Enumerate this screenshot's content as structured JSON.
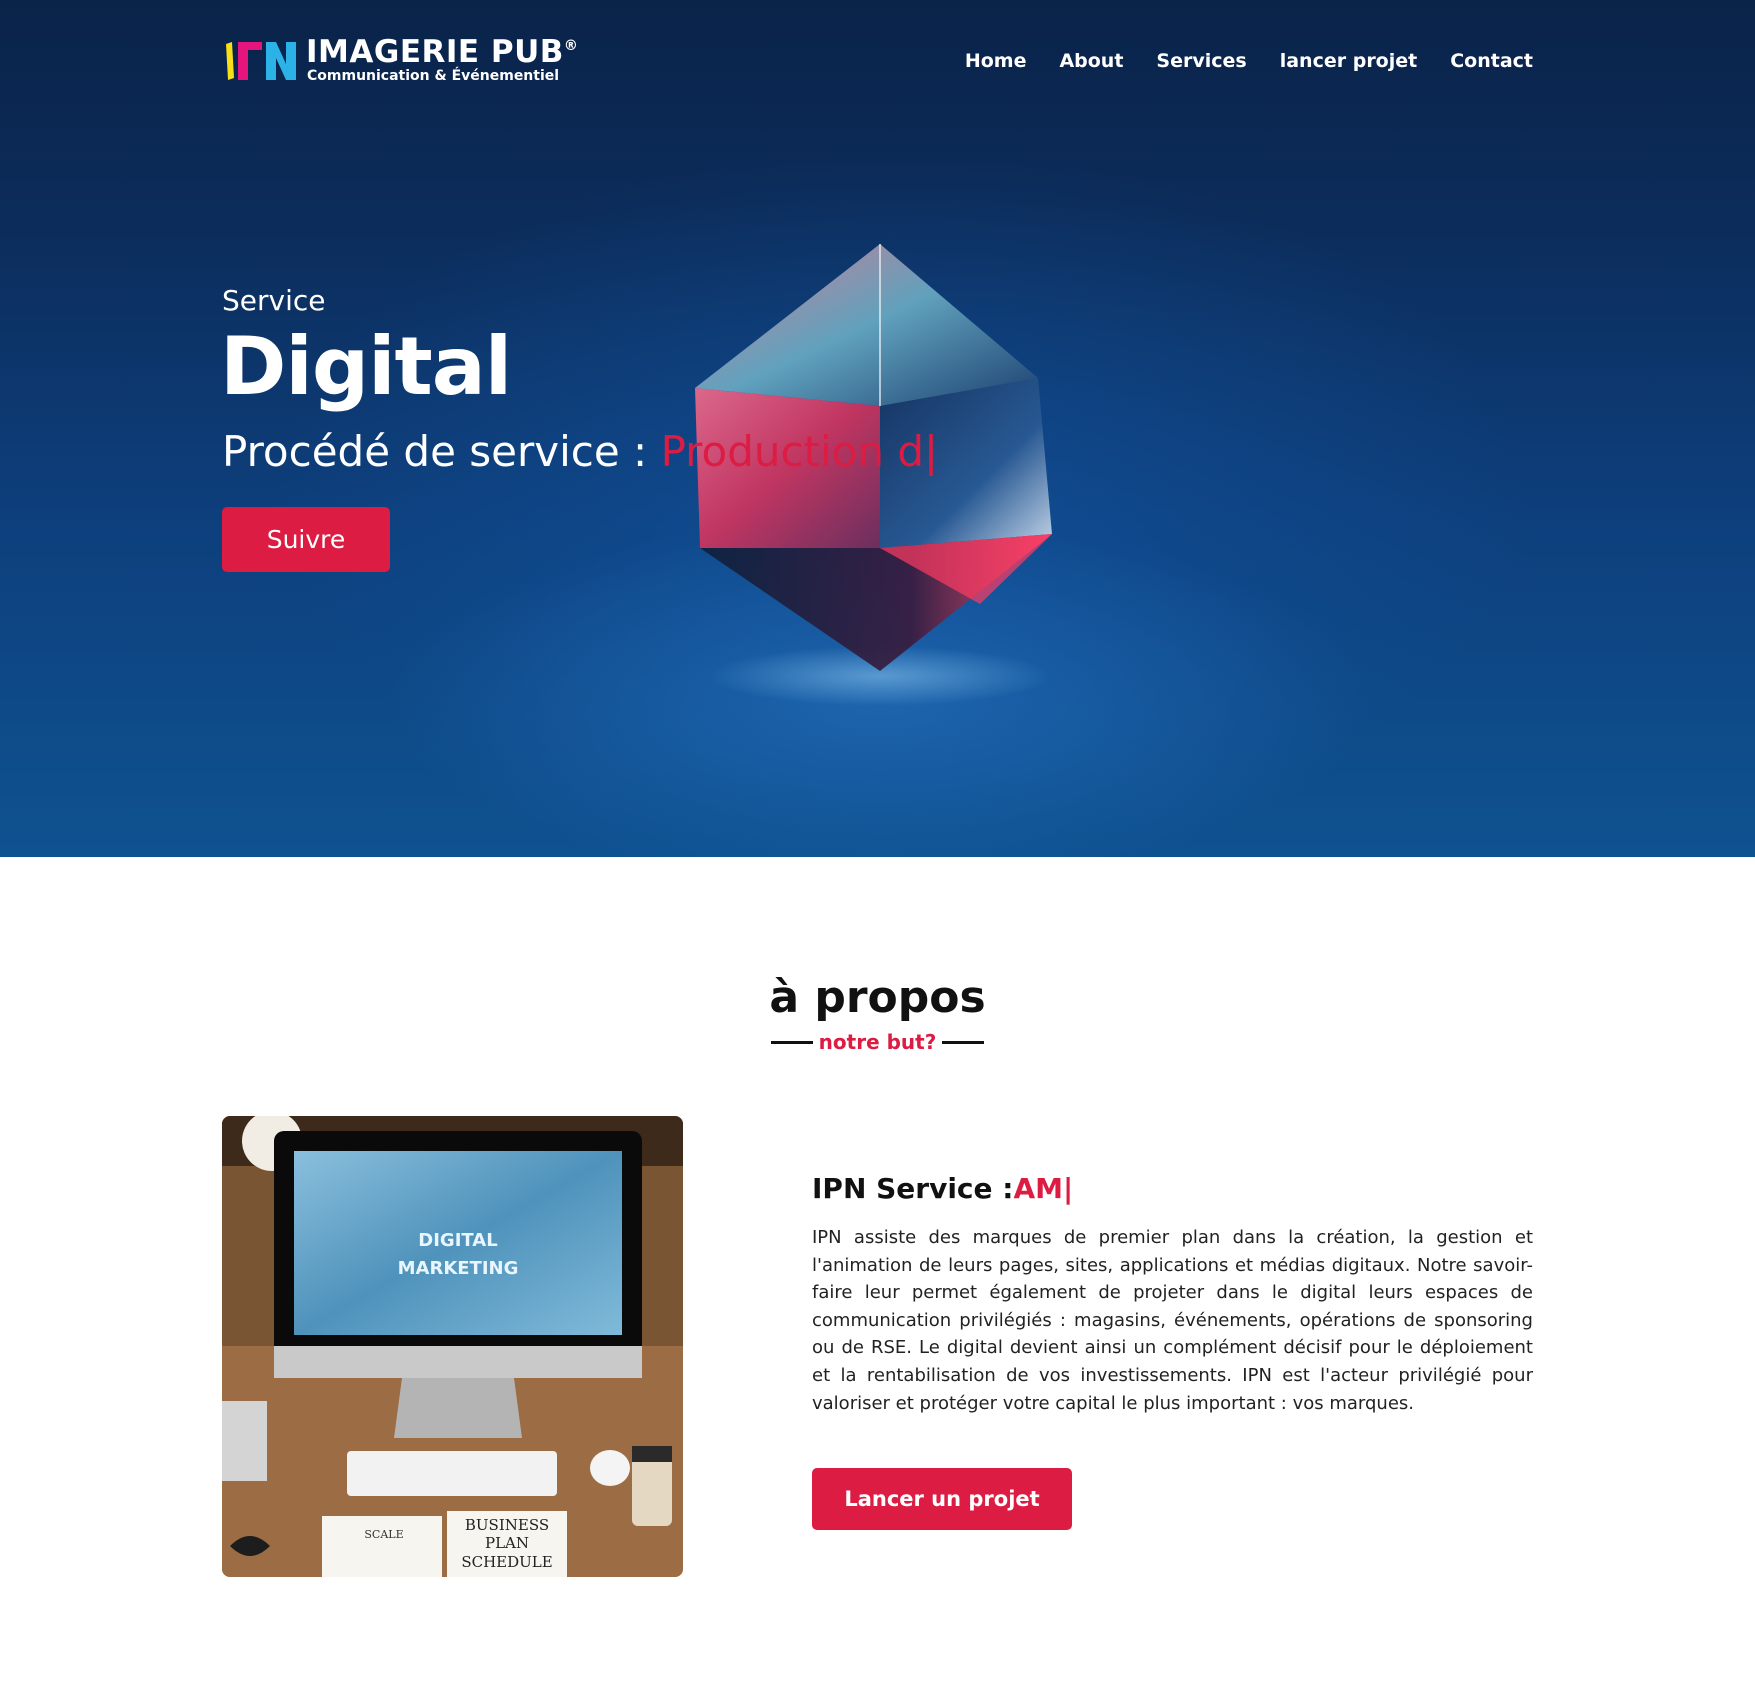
{
  "brand": {
    "title": "IMAGERIE PUB",
    "registered": "®",
    "subtitle": "Communication & Événementiel",
    "mark_colors": [
      "#f7e01a",
      "#e5157d",
      "#2bb3e8"
    ]
  },
  "nav": {
    "items": [
      "Home",
      "About",
      "Services",
      "lancer projet",
      "Contact"
    ]
  },
  "hero": {
    "kicker": "Service",
    "title": "Digital",
    "line_prefix": "Procédé de service : ",
    "line_typed": "Production d|",
    "button_label": "Suivre"
  },
  "about": {
    "title": "à propos",
    "subtitle": "notre but?",
    "image_screen_text_1": "DIGITAL",
    "image_screen_text_2": "MARKETING",
    "image_note_1": "SCALE",
    "image_note_2": "BUSINESS",
    "image_note_3": "PLAN",
    "image_note_4": "SCHEDULE",
    "heading_prefix": "IPN Service :",
    "heading_typed": "AM|",
    "paragraph": "IPN assiste des marques de premier plan dans la création, la gestion et l'animation de leurs pages, sites, applications et médias digitaux. Notre savoir-faire leur permet également de projeter dans le digital leurs espaces de communication privilégiés : magasins, événements, opérations de sponsoring ou de RSE. Le digital devient ainsi un complément décisif pour le déploiement et la rentabilisation de vos investissements. IPN est l'acteur privilégié pour valoriser et protéger votre capital le plus important : vos marques.",
    "button_label": "Lancer un projet"
  },
  "colors": {
    "accent": "#dc1c42",
    "hero_dark": "#0a2349",
    "hero_light": "#0f5291"
  }
}
